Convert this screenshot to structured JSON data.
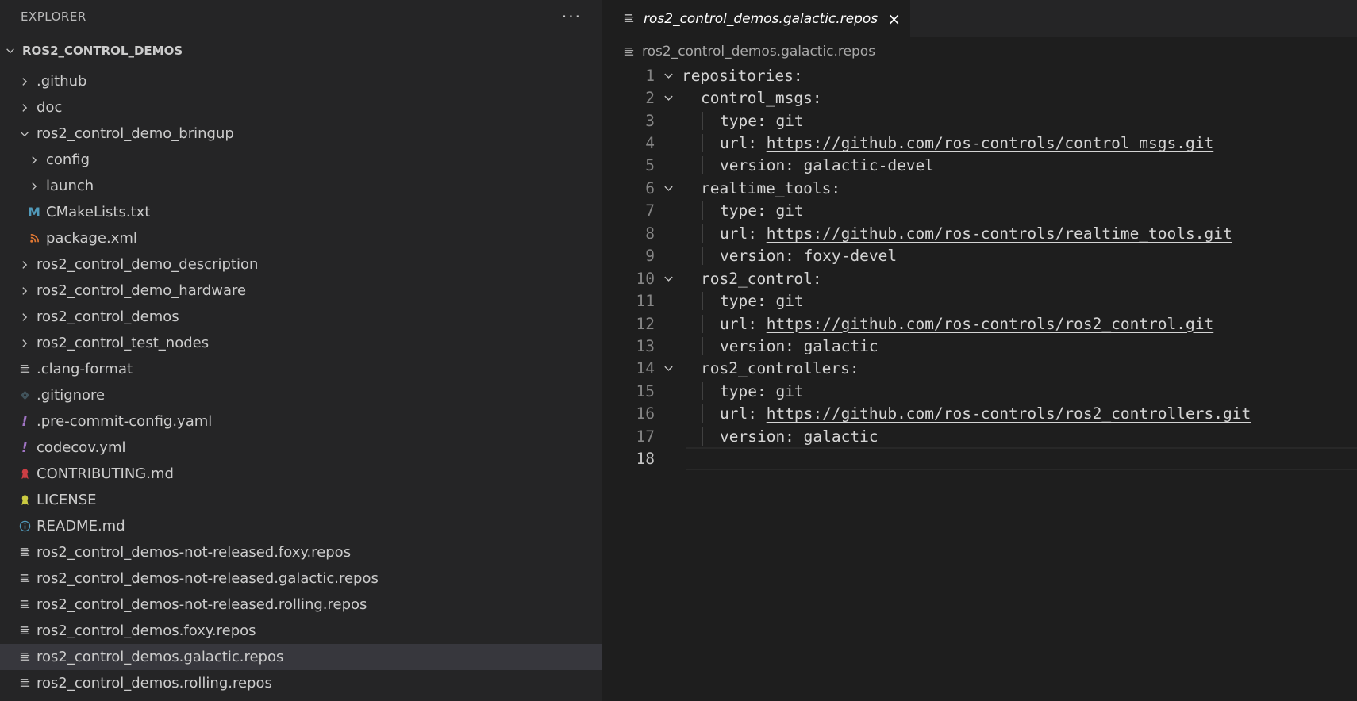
{
  "explorer": {
    "title": "EXPLORER",
    "more_label": "···",
    "root": "ROS2_CONTROL_DEMOS",
    "items": [
      {
        "label": ".github",
        "kind": "folder",
        "level": 0,
        "open": false,
        "icon": "chevron-right-icon"
      },
      {
        "label": "doc",
        "kind": "folder",
        "level": 0,
        "open": false,
        "icon": "chevron-right-icon"
      },
      {
        "label": "ros2_control_demo_bringup",
        "kind": "folder",
        "level": 0,
        "open": true,
        "icon": "chevron-down-icon"
      },
      {
        "label": "config",
        "kind": "folder",
        "level": 1,
        "open": false,
        "icon": "chevron-right-icon"
      },
      {
        "label": "launch",
        "kind": "folder",
        "level": 1,
        "open": false,
        "icon": "chevron-right-icon"
      },
      {
        "label": "CMakeLists.txt",
        "kind": "file",
        "level": 1,
        "icon": "cmake-file-icon",
        "glyph": "M",
        "color": "#519aba"
      },
      {
        "label": "package.xml",
        "kind": "file",
        "level": 1,
        "icon": "rss-xml-file-icon",
        "glyph": "rss",
        "color": "#e37933"
      },
      {
        "label": "ros2_control_demo_description",
        "kind": "folder",
        "level": 0,
        "open": false,
        "icon": "chevron-right-icon"
      },
      {
        "label": "ros2_control_demo_hardware",
        "kind": "folder",
        "level": 0,
        "open": false,
        "icon": "chevron-right-icon"
      },
      {
        "label": "ros2_control_demos",
        "kind": "folder",
        "level": 0,
        "open": false,
        "icon": "chevron-right-icon"
      },
      {
        "label": "ros2_control_test_nodes",
        "kind": "folder",
        "level": 0,
        "open": false,
        "icon": "chevron-right-icon"
      },
      {
        "label": ".clang-format",
        "kind": "file",
        "level": 0,
        "icon": "lines-file-icon",
        "glyph": "lines",
        "color": "#c5c5c5"
      },
      {
        "label": ".gitignore",
        "kind": "file",
        "level": 0,
        "icon": "git-diamond-icon",
        "glyph": "diamond",
        "color": "#41535b"
      },
      {
        "label": ".pre-commit-config.yaml",
        "kind": "file",
        "level": 0,
        "icon": "yaml-exclamation-icon",
        "glyph": "!",
        "color": "#a074c4"
      },
      {
        "label": "codecov.yml",
        "kind": "file",
        "level": 0,
        "icon": "yaml-exclamation-icon",
        "glyph": "!",
        "color": "#a074c4"
      },
      {
        "label": "CONTRIBUTING.md",
        "kind": "file",
        "level": 0,
        "icon": "ribbon-icon",
        "glyph": "ribbon",
        "color": "#cc3e44"
      },
      {
        "label": "LICENSE",
        "kind": "file",
        "level": 0,
        "icon": "license-ribbon-icon",
        "glyph": "ribbon",
        "color": "#cbcb41"
      },
      {
        "label": "README.md",
        "kind": "file",
        "level": 0,
        "icon": "info-icon",
        "glyph": "info",
        "color": "#519aba"
      },
      {
        "label": "ros2_control_demos-not-released.foxy.repos",
        "kind": "file",
        "level": 0,
        "icon": "lines-file-icon",
        "glyph": "lines",
        "color": "#c5c5c5"
      },
      {
        "label": "ros2_control_demos-not-released.galactic.repos",
        "kind": "file",
        "level": 0,
        "icon": "lines-file-icon",
        "glyph": "lines",
        "color": "#c5c5c5"
      },
      {
        "label": "ros2_control_demos-not-released.rolling.repos",
        "kind": "file",
        "level": 0,
        "icon": "lines-file-icon",
        "glyph": "lines",
        "color": "#c5c5c5"
      },
      {
        "label": "ros2_control_demos.foxy.repos",
        "kind": "file",
        "level": 0,
        "icon": "lines-file-icon",
        "glyph": "lines",
        "color": "#c5c5c5"
      },
      {
        "label": "ros2_control_demos.galactic.repos",
        "kind": "file",
        "level": 0,
        "icon": "lines-file-icon",
        "glyph": "lines",
        "color": "#c5c5c5",
        "selected": true
      },
      {
        "label": "ros2_control_demos.rolling.repos",
        "kind": "file",
        "level": 0,
        "icon": "lines-file-icon",
        "glyph": "lines",
        "color": "#c5c5c5"
      }
    ]
  },
  "editor": {
    "tab_label": "ros2_control_demos.galactic.repos",
    "close_label": "×",
    "breadcrumb": "ros2_control_demos.galactic.repos",
    "lines": [
      {
        "n": "1",
        "indent": 0,
        "fold": true,
        "key": "repositories:",
        "val": ""
      },
      {
        "n": "2",
        "indent": 1,
        "fold": true,
        "key": "control_msgs:",
        "val": ""
      },
      {
        "n": "3",
        "indent": 2,
        "fold": false,
        "key": "type: ",
        "val": "git"
      },
      {
        "n": "4",
        "indent": 2,
        "fold": false,
        "key": "url: ",
        "val": "https://github.com/ros-controls/control_msgs.git",
        "url": true
      },
      {
        "n": "5",
        "indent": 2,
        "fold": false,
        "key": "version: ",
        "val": "galactic-devel"
      },
      {
        "n": "6",
        "indent": 1,
        "fold": true,
        "key": "realtime_tools:",
        "val": ""
      },
      {
        "n": "7",
        "indent": 2,
        "fold": false,
        "key": "type: ",
        "val": "git"
      },
      {
        "n": "8",
        "indent": 2,
        "fold": false,
        "key": "url: ",
        "val": "https://github.com/ros-controls/realtime_tools.git",
        "url": true
      },
      {
        "n": "9",
        "indent": 2,
        "fold": false,
        "key": "version: ",
        "val": "foxy-devel"
      },
      {
        "n": "10",
        "indent": 1,
        "fold": true,
        "key": "ros2_control:",
        "val": ""
      },
      {
        "n": "11",
        "indent": 2,
        "fold": false,
        "key": "type: ",
        "val": "git"
      },
      {
        "n": "12",
        "indent": 2,
        "fold": false,
        "key": "url: ",
        "val": "https://github.com/ros-controls/ros2_control.git",
        "url": true
      },
      {
        "n": "13",
        "indent": 2,
        "fold": false,
        "key": "version: ",
        "val": "galactic"
      },
      {
        "n": "14",
        "indent": 1,
        "fold": true,
        "key": "ros2_controllers:",
        "val": ""
      },
      {
        "n": "15",
        "indent": 2,
        "fold": false,
        "key": "type: ",
        "val": "git"
      },
      {
        "n": "16",
        "indent": 2,
        "fold": false,
        "key": "url: ",
        "val": "https://github.com/ros-controls/ros2_controllers.git",
        "url": true
      },
      {
        "n": "17",
        "indent": 2,
        "fold": false,
        "key": "version: ",
        "val": "galactic"
      },
      {
        "n": "18",
        "indent": 0,
        "fold": false,
        "key": "",
        "val": "",
        "current": true
      }
    ]
  }
}
